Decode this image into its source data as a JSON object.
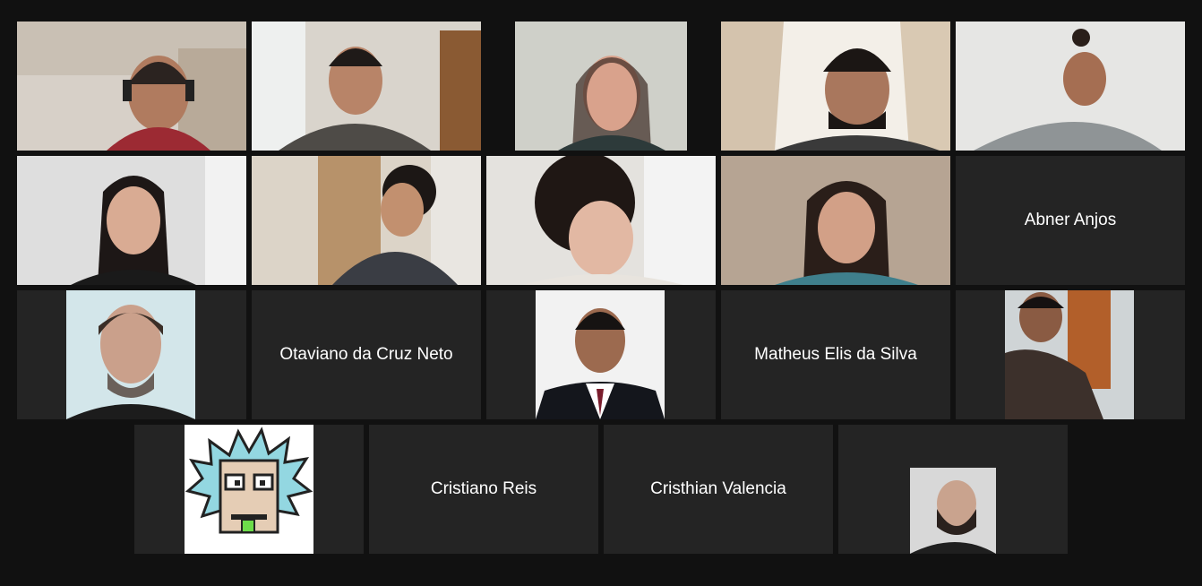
{
  "meeting": {
    "view": "gallery",
    "participant_count": 19,
    "participants": [
      {
        "id": "p01",
        "name": "",
        "display": "video",
        "bg": "#d7d0c8"
      },
      {
        "id": "p02",
        "name": "",
        "display": "video",
        "bg": "#d9d4cc"
      },
      {
        "id": "p03",
        "name": "",
        "display": "video",
        "bg": "#cfd0c9"
      },
      {
        "id": "p04",
        "name": "",
        "display": "video",
        "bg": "#e1d6c8"
      },
      {
        "id": "p05",
        "name": "",
        "display": "video",
        "bg": "#e6e6e4"
      },
      {
        "id": "p06",
        "name": "",
        "display": "video",
        "bg": "#dedede"
      },
      {
        "id": "p07",
        "name": "",
        "display": "video",
        "bg": "#dcd4c8"
      },
      {
        "id": "p08",
        "name": "",
        "display": "video",
        "bg": "#e4e2de"
      },
      {
        "id": "p09",
        "name": "",
        "display": "video",
        "bg": "#b6a493",
        "active_speaker": true
      },
      {
        "id": "p10",
        "name": "Abner Anjos",
        "display": "name"
      },
      {
        "id": "p11",
        "name": "",
        "display": "profile_photo",
        "bg": "#d3e6ea"
      },
      {
        "id": "p12",
        "name": "Otaviano da Cruz Neto",
        "display": "name"
      },
      {
        "id": "p13",
        "name": "",
        "display": "profile_photo",
        "bg": "#f2f2f2"
      },
      {
        "id": "p14",
        "name": "Matheus Elis da Silva",
        "display": "name"
      },
      {
        "id": "p15",
        "name": "",
        "display": "profile_photo",
        "bg": "#cfd4d6"
      },
      {
        "id": "p16",
        "name": "",
        "display": "profile_photo",
        "bg": "#ffffff",
        "avatar": "pixel-art-cartoon"
      },
      {
        "id": "p17",
        "name": "Cristiano Reis",
        "display": "name"
      },
      {
        "id": "p18",
        "name": "Cristhian Valencia",
        "display": "name"
      },
      {
        "id": "p19",
        "name": "",
        "display": "profile_photo",
        "bg": "#d8d8d8"
      }
    ]
  },
  "colors": {
    "window_bg": "#111111",
    "tile_bg": "#242424",
    "active_speaker_border": "#c8df3c",
    "name_text": "#ffffff"
  },
  "icons": {
    "avatar_placeholder": "person-icon"
  }
}
